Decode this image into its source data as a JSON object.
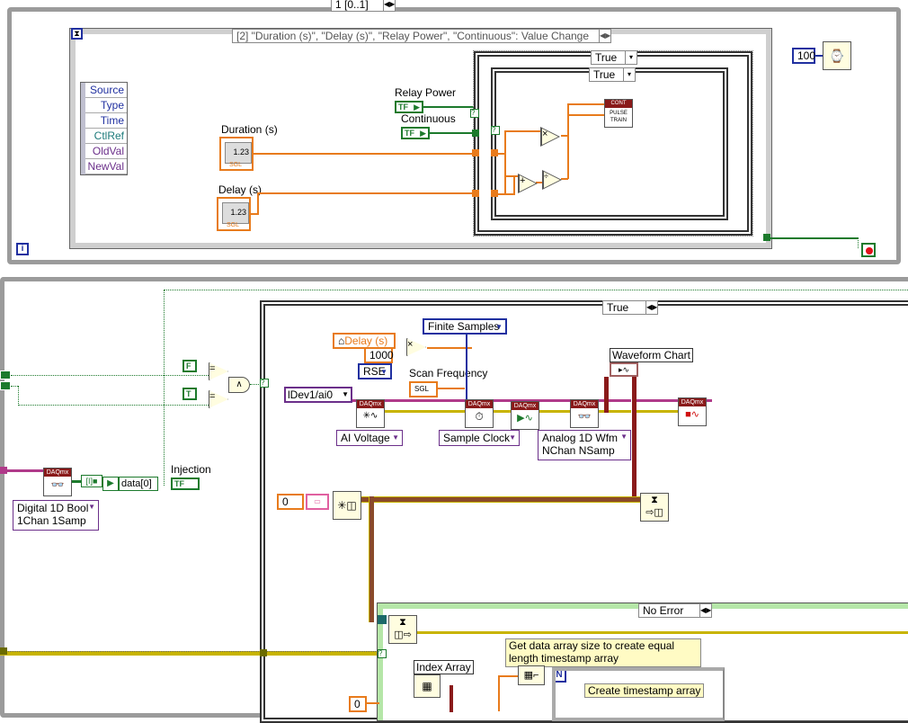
{
  "top_selector": {
    "value": "1 [0..1]"
  },
  "event_structure": {
    "case_label": "[2] \"Duration (s)\", \"Delay (s)\", \"Relay Power\", \"Continuous\": Value Change"
  },
  "event_data": {
    "items": [
      "Source",
      "Type",
      "Time",
      "CtlRef",
      "OldVal",
      "NewVal"
    ]
  },
  "controls": {
    "relay_power": "Relay Power",
    "continuous": "Continuous",
    "duration": "Duration (s)",
    "delay": "Delay (s)",
    "num_display": "1.23",
    "sgl": "SGL",
    "tf": "TF"
  },
  "case_true_outer": "True",
  "case_true_inner": "True",
  "pulse_vi": {
    "header": "CONT",
    "body": "PULSE TRAIN"
  },
  "wait_constant": "100",
  "info_icon": "i",
  "lower": {
    "case_label": "True",
    "delay_local": "Delay (s)",
    "const_1000": "1000",
    "finite_samples": "Finite Samples",
    "rse": "RSE",
    "scan_frequency": "Scan Frequency",
    "waveform_chart": "Waveform Chart",
    "channel": "Dev1/ai0",
    "ai_voltage": "AI Voltage",
    "sample_clock": "Sample Clock",
    "read_mode": "Analog 1D Wfm NChan NSamp",
    "read_mode_line1": "Analog 1D Wfm",
    "read_mode_line2": "NChan NSamp",
    "digital_mode_line1": "Digital 1D Bool",
    "digital_mode_line2": "1Chan 1Samp",
    "data0": "data[0]",
    "injection": "Injection",
    "f_const": "F",
    "t_const": "T",
    "zero_const": "0",
    "zero_const2": "0",
    "daqmx": "DAQmx",
    "no_error": "No Error",
    "index_array": "Index Array",
    "comment1_line1": "Get data array size to create equal",
    "comment1_line2": "length timestamp array",
    "create_timestamp": "Create timestamp array",
    "n_terminal": "N"
  },
  "colors": {
    "frame_gray": "#9b9b9b",
    "wire_orange": "#e87b1c",
    "wire_green": "#1c7a2c",
    "wire_pink": "#b03a8a",
    "error_wire": "#c8b400",
    "dark_red": "#8a1a1a"
  }
}
